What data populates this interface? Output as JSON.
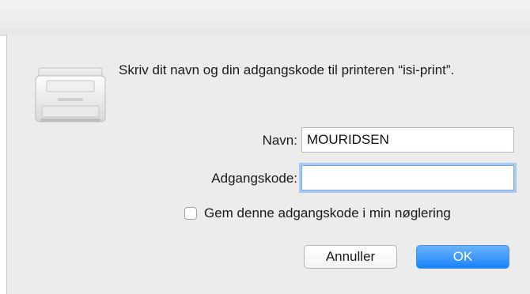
{
  "dialog": {
    "message": "Skriv dit navn og din adgangskode til printeren “isi-print”.",
    "icon": "printer-icon"
  },
  "form": {
    "name_label": "Navn:",
    "name_value": "MOURIDSEN",
    "password_label": "Adgangskode:",
    "password_value": "",
    "remember_label": "Gem denne adgangskode i min nøglering",
    "remember_checked": false
  },
  "buttons": {
    "cancel_label": "Annuller",
    "ok_label": "OK"
  },
  "colors": {
    "accent": "#1a82fb",
    "dialog_background": "#ececec",
    "focus_ring": "#a9c8f2"
  }
}
